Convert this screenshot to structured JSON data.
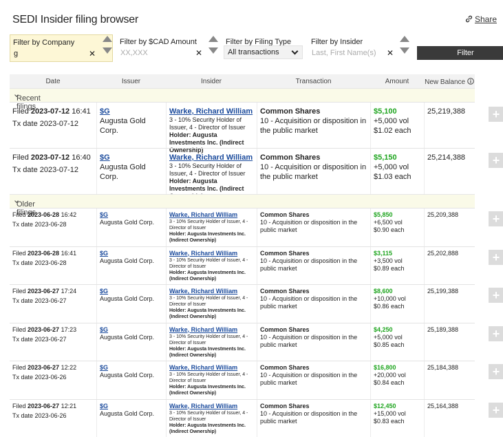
{
  "page": {
    "title": "SEDI Insider filing browser",
    "share_label": "Share"
  },
  "filters": {
    "company": {
      "label": "Filter by Company",
      "value": "g"
    },
    "amount": {
      "label": "Filter by $CAD Amount",
      "placeholder": "XX,XXX"
    },
    "filing_type": {
      "label": "Filter by Filing Type",
      "value": "All transactions"
    },
    "insider": {
      "label": "Filter by Insider",
      "placeholder": "Last, First Name(s)"
    },
    "button_label": "Filter"
  },
  "table": {
    "headers": [
      "Date",
      "Issuer",
      "Insider",
      "Transaction",
      "Amount",
      "New Balance"
    ],
    "recent_label": "Recent filings",
    "older_label": "Older filings",
    "recent": [
      {
        "filed_prefix": "Filed ",
        "filed_date": "2023-07-12",
        "filed_time": " 16:41",
        "tx": "Tx date 2023-07-12",
        "symbol": "$G",
        "issuer": "Augusta Gold Corp.",
        "insider": "Warke, Richard William",
        "relation": "3 - 10% Security Holder of Issuer, 4 - Director of Issuer",
        "holder": "Holder: Augusta Investments Inc. (Indirect Ownership)",
        "security": "Common Shares",
        "nature": "10 - Acquisition or disposition in the public market",
        "amount": "$5,100",
        "vol": "+5,000 vol",
        "each": "$1.02 each",
        "balance": "25,219,388"
      },
      {
        "filed_prefix": "Filed ",
        "filed_date": "2023-07-12",
        "filed_time": " 16:40",
        "tx": "Tx date 2023-07-12",
        "symbol": "$G",
        "issuer": "Augusta Gold Corp.",
        "insider": "Warke, Richard William",
        "relation": "3 - 10% Security Holder of Issuer, 4 - Director of Issuer",
        "holder": "Holder: Augusta Investments Inc. (Indirect Ownership)",
        "security": "Common Shares",
        "nature": "10 - Acquisition or disposition in the public market",
        "amount": "$5,150",
        "vol": "+5,000 vol",
        "each": "$1.03 each",
        "balance": "25,214,388"
      }
    ],
    "older": [
      {
        "filed_prefix": "Filed ",
        "filed_date": "2023-06-28",
        "filed_time": " 16:42",
        "tx": "Tx date 2023-06-28",
        "symbol": "$G",
        "issuer": "Augusta Gold Corp.",
        "insider": "Warke, Richard William",
        "relation": "3 - 10% Security Holder of Issuer, 4 - Director of Issuer",
        "holder": "Holder: Augusta Investments Inc. (Indirect Ownership)",
        "security": "Common Shares",
        "nature": "10 - Acquisition or disposition in the public market",
        "amount": "$5,850",
        "vol": "+6,500 vol",
        "each": "$0.90 each",
        "balance": "25,209,388"
      },
      {
        "filed_prefix": "Filed ",
        "filed_date": "2023-06-28",
        "filed_time": " 16:41",
        "tx": "Tx date 2023-06-28",
        "symbol": "$G",
        "issuer": "Augusta Gold Corp.",
        "insider": "Warke, Richard William",
        "relation": "3 - 10% Security Holder of Issuer, 4 - Director of Issuer",
        "holder": "Holder: Augusta Investments Inc. (Indirect Ownership)",
        "security": "Common Shares",
        "nature": "10 - Acquisition or disposition in the public market",
        "amount": "$3,115",
        "vol": "+3,500 vol",
        "each": "$0.89 each",
        "balance": "25,202,888"
      },
      {
        "filed_prefix": "Filed ",
        "filed_date": "2023-06-27",
        "filed_time": " 17:24",
        "tx": "Tx date 2023-06-27",
        "symbol": "$G",
        "issuer": "Augusta Gold Corp.",
        "insider": "Warke, Richard William",
        "relation": "3 - 10% Security Holder of Issuer, 4 - Director of Issuer",
        "holder": "Holder: Augusta Investments Inc. (Indirect Ownership)",
        "security": "Common Shares",
        "nature": "10 - Acquisition or disposition in the public market",
        "amount": "$8,600",
        "vol": "+10,000 vol",
        "each": "$0.86 each",
        "balance": "25,199,388"
      },
      {
        "filed_prefix": "Filed ",
        "filed_date": "2023-06-27",
        "filed_time": " 17:23",
        "tx": "Tx date 2023-06-27",
        "symbol": "$G",
        "issuer": "Augusta Gold Corp.",
        "insider": "Warke, Richard William",
        "relation": "3 - 10% Security Holder of Issuer, 4 - Director of Issuer",
        "holder": "Holder: Augusta Investments Inc. (Indirect Ownership)",
        "security": "Common Shares",
        "nature": "10 - Acquisition or disposition in the public market",
        "amount": "$4,250",
        "vol": "+5,000 vol",
        "each": "$0.85 each",
        "balance": "25,189,388"
      },
      {
        "filed_prefix": "Filed ",
        "filed_date": "2023-06-27",
        "filed_time": " 12:22",
        "tx": "Tx date 2023-06-26",
        "symbol": "$G",
        "issuer": "Augusta Gold Corp.",
        "insider": "Warke, Richard William",
        "relation": "3 - 10% Security Holder of Issuer, 4 - Director of Issuer",
        "holder": "Holder: Augusta Investments Inc. (Indirect Ownership)",
        "security": "Common Shares",
        "nature": "10 - Acquisition or disposition in the public market",
        "amount": "$16,800",
        "vol": "+20,000 vol",
        "each": "$0.84 each",
        "balance": "25,184,388"
      },
      {
        "filed_prefix": "Filed ",
        "filed_date": "2023-06-27",
        "filed_time": " 12:21",
        "tx": "Tx date 2023-06-26",
        "symbol": "$G",
        "issuer": "Augusta Gold Corp.",
        "insider": "Warke, Richard William",
        "relation": "3 - 10% Security Holder of Issuer, 4 - Director of Issuer",
        "holder": "Holder: Augusta Investments Inc. (Indirect Ownership)",
        "security": "Common Shares",
        "nature": "10 - Acquisition or disposition in the public market",
        "amount": "$12,450",
        "vol": "+15,000 vol",
        "each": "$0.83 each",
        "balance": "25,164,388"
      }
    ]
  },
  "icons": {
    "share": "link-icon",
    "info": "info-icon",
    "expand": "plus-icon",
    "section_toggle": "chevron-down-icon"
  },
  "colors": {
    "amount_green": "#1fa51f",
    "link_blue": "#1a4a9c",
    "filter_button": "#3a3a3a",
    "company_filter_bg": "#fdf7d6"
  }
}
